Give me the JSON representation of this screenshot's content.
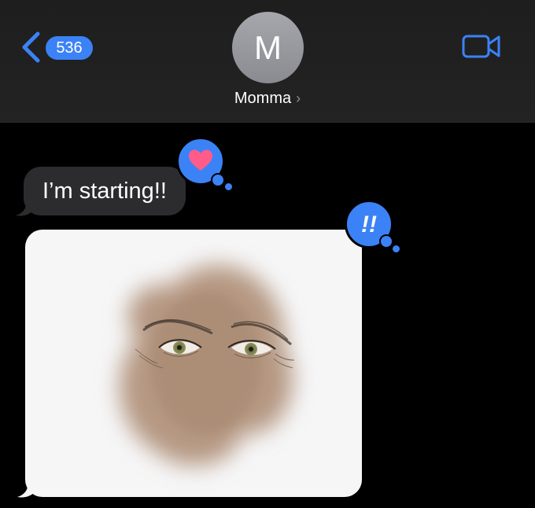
{
  "header": {
    "unread_count": "536",
    "avatar_initial": "M",
    "contact_name": "Momma",
    "contact_chevron": "›",
    "accent": "#3b82f6",
    "icons": {
      "back": "chevron-left-icon",
      "video": "video-camera-icon"
    }
  },
  "messages": [
    {
      "type": "text",
      "text": "I’m starting!!",
      "tapback": "heart"
    },
    {
      "type": "image",
      "description_icon": "drawing-image",
      "tapback": "double-exclamation"
    }
  ],
  "tapbacks": {
    "heart_color": "#ff5c8a",
    "bubble_color": "#3b82f6",
    "exclaim_glyph": "!!"
  }
}
